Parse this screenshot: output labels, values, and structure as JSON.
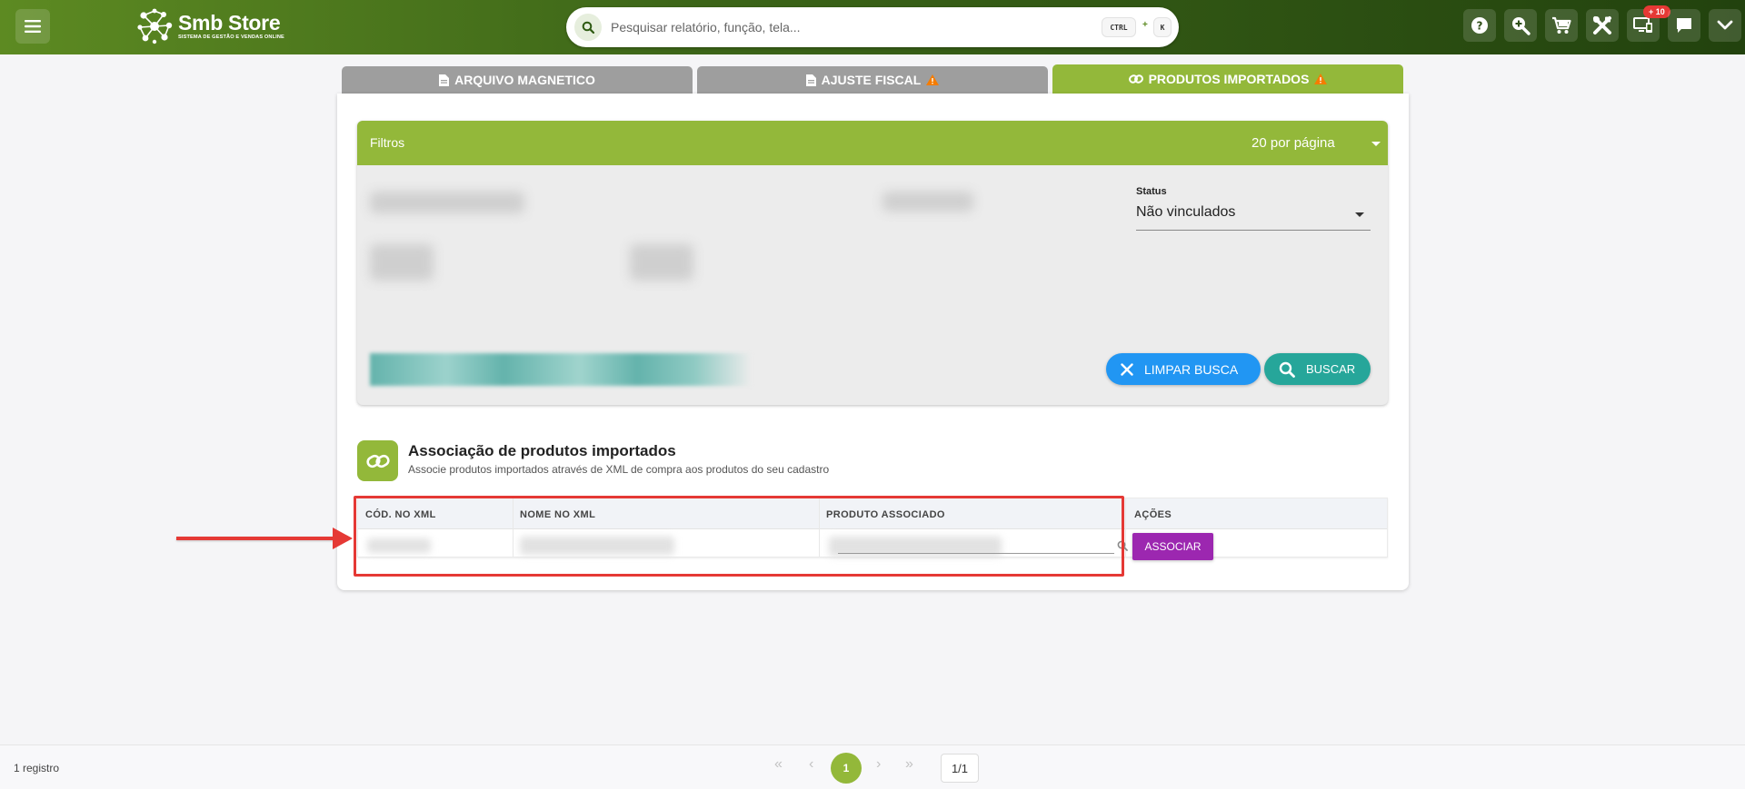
{
  "header": {
    "logo_title": "Smb Store",
    "logo_subtitle": "SISTEMA DE GESTÃO E VENDAS ONLINE",
    "search_placeholder": "Pesquisar relatório, função, tela...",
    "kbd_ctrl": "CTRL",
    "kbd_plus": "+",
    "kbd_k": "K",
    "notification_badge": "+ 10",
    "accent_color": "#5d8a22"
  },
  "tabs": [
    {
      "label": "ARQUIVO MAGNETICO",
      "icon": "document-icon",
      "active": false
    },
    {
      "label": "AJUSTE FISCAL",
      "icon": "document-icon",
      "warning": true,
      "active": false
    },
    {
      "label": "PRODUTOS IMPORTADOS",
      "icon": "link-icon",
      "warning": true,
      "active": true
    }
  ],
  "filters": {
    "title": "Filtros",
    "per_page": "20 por página",
    "status_label": "Status",
    "status_value": "Não vinculados",
    "clear_button": "LIMPAR BUSCA",
    "search_button": "BUSCAR"
  },
  "section": {
    "title": "Associação de produtos importados",
    "subtitle": "Associe produtos importados através de XML de compra aos produtos do seu cadastro"
  },
  "table": {
    "columns": [
      "CÓD. NO XML",
      "NOME NO XML",
      "PRODUTO ASSOCIADO",
      "AÇÕES"
    ],
    "action_button": "ASSOCIAR"
  },
  "footer": {
    "records": "1 registro",
    "current_page": "1",
    "page_total": "1/1"
  },
  "colors": {
    "primary_green": "#93b83a",
    "clear_blue": "#2196f3",
    "search_teal": "#26a69a",
    "action_purple": "#9c27b0",
    "highlight_red": "#e53935",
    "warning_orange": "#f57c00"
  }
}
